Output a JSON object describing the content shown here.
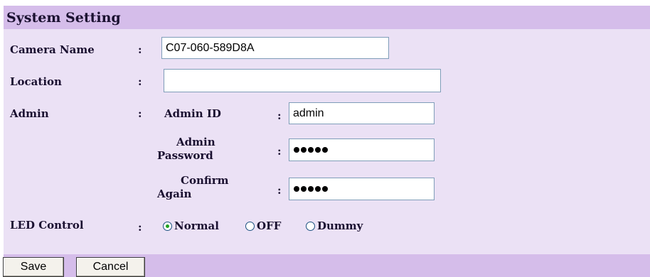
{
  "header": {
    "title": "System Setting"
  },
  "colon": ":",
  "camera_name": {
    "label": "Camera Name",
    "value": "C07-060-589D8A"
  },
  "location": {
    "label": "Location",
    "value": ""
  },
  "admin": {
    "label": "Admin",
    "id_label": "Admin ID",
    "id_value": "admin",
    "password_label_line1": "Admin",
    "password_label_line2": "Password",
    "password_length": 5,
    "confirm_label_line1": "Confirm",
    "confirm_label_line2": "Again",
    "confirm_length": 5
  },
  "led_control": {
    "label": "LED Control",
    "options": [
      "Normal",
      "OFF",
      "Dummy"
    ],
    "selected": "Normal"
  },
  "buttons": {
    "save": "Save",
    "cancel": "Cancel"
  },
  "colors": {
    "header_bg": "#d5bdea",
    "panel_bg": "#ebe1f5",
    "radio_dot": "#21a121"
  }
}
